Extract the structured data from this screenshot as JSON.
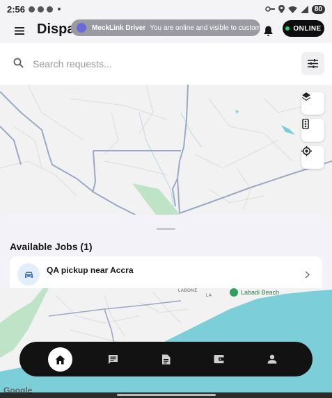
{
  "status_bar": {
    "time": "2:56",
    "battery": "80"
  },
  "header": {
    "title": "Dispat",
    "status_label": "ONLINE",
    "icons": [
      "menu-icon",
      "bell-icon"
    ]
  },
  "toast": {
    "app_name": "MeckLink Driver",
    "message": "You are online and visible to customers."
  },
  "search": {
    "placeholder": "Search requests...",
    "value": "",
    "icons": [
      "search-icon",
      "filter-sliders-icon"
    ]
  },
  "map": {
    "controls": [
      "layers-icon",
      "traffic-icon",
      "my-location-icon"
    ],
    "labels": {
      "area1": "LABONE",
      "area2": "LA",
      "beach": "Labadi Beach"
    },
    "attribution": "Google",
    "colors": {
      "land": "#f2f2f2",
      "water": "#7ccfd8",
      "park": "#bfe3c6",
      "road": "#9aa9c4"
    }
  },
  "jobs": {
    "section_title": "Available Jobs (1)",
    "items": [
      {
        "title": "QA pickup near Accra",
        "icon": "car-icon"
      }
    ]
  },
  "bottom_nav": {
    "items": [
      {
        "icon": "home-icon",
        "active": true
      },
      {
        "icon": "chat-icon",
        "active": false
      },
      {
        "icon": "document-icon",
        "active": false
      },
      {
        "icon": "wallet-icon",
        "active": false
      },
      {
        "icon": "person-icon",
        "active": false
      }
    ]
  },
  "colors": {
    "accent_dark": "#121212",
    "online_dot": "#2ecc71",
    "toast_bg": "#9a9aa3"
  }
}
